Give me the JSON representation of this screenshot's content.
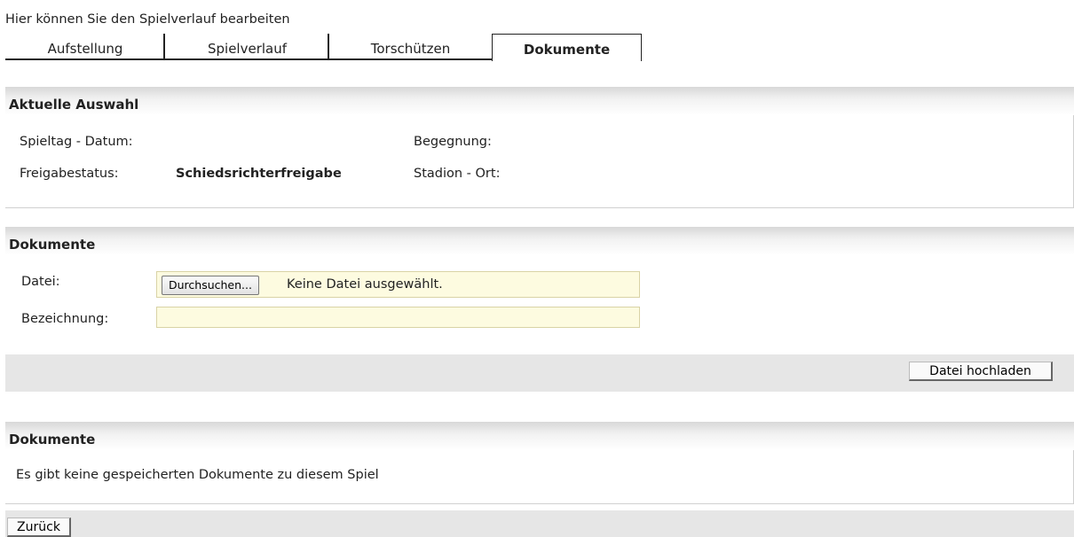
{
  "intro_text": "Hier können Sie den Spielverlauf bearbeiten",
  "tabs": [
    {
      "label": "Aufstellung"
    },
    {
      "label": "Spielverlauf"
    },
    {
      "label": "Torschützen"
    },
    {
      "label": "Dokumente",
      "active": true
    }
  ],
  "selection": {
    "title": "Aktuelle Auswahl",
    "spieltag_label": "Spieltag - Datum:",
    "spieltag_value": "",
    "begegnung_label": "Begegnung:",
    "begegnung_value": "",
    "freigabe_label": "Freigabestatus:",
    "freigabe_value": "Schiedsrichterfreigabe",
    "stadion_label": "Stadion - Ort:",
    "stadion_value": ""
  },
  "upload": {
    "title": "Dokumente",
    "file_label": "Datei:",
    "browse_button": "Durchsuchen...",
    "file_status": "Keine Datei ausgewählt.",
    "bezeichnung_label": "Bezeichnung:",
    "bezeichnung_value": "",
    "upload_button": "Datei hochladen"
  },
  "documents": {
    "title": "Dokumente",
    "empty_message": "Es gibt keine gespeicherten Dokumente zu diesem Spiel"
  },
  "footer": {
    "back_button": "Zurück"
  },
  "colors": {
    "input_background": "#fdfbe0",
    "toolbar_grey": "#e6e6e6"
  }
}
